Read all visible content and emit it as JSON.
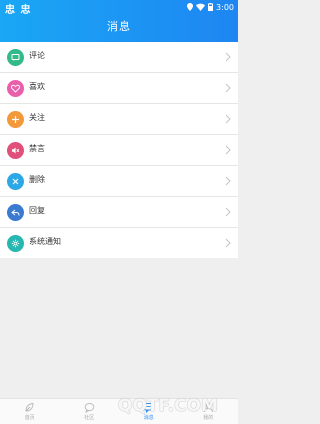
{
  "status": {
    "left_text": "忠 忠",
    "time": "3:00"
  },
  "header": {
    "title": "消息"
  },
  "messages": [
    {
      "label": "评论",
      "icon": "comment-icon",
      "color": "#33b98a"
    },
    {
      "label": "喜欢",
      "icon": "heart-icon",
      "color": "#ea5fab"
    },
    {
      "label": "关注",
      "icon": "plus-icon",
      "color": "#f3993a"
    },
    {
      "label": "禁言",
      "icon": "mute-icon",
      "color": "#e0507a"
    },
    {
      "label": "删除",
      "icon": "close-icon",
      "color": "#2ca9e4"
    },
    {
      "label": "回复",
      "icon": "reply-icon",
      "color": "#3a7ad0"
    },
    {
      "label": "系统通知",
      "icon": "gear-icon",
      "color": "#27b6b0"
    }
  ],
  "tabs": [
    {
      "label": "首页",
      "icon": "leaf-icon"
    },
    {
      "label": "社区",
      "icon": "chat-bubble-icon"
    },
    {
      "label": "消息",
      "icon": "message-icon",
      "active": true
    },
    {
      "label": "我的",
      "icon": "profile-icon"
    }
  ],
  "watermark": "QQTF.COM"
}
